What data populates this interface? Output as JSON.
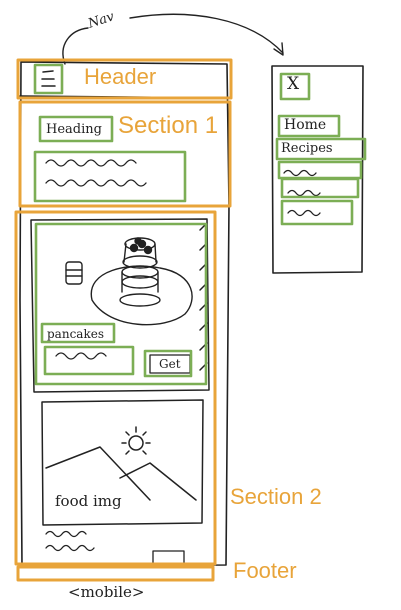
{
  "annotations": {
    "header": "Header",
    "section_1": "Section 1",
    "section_2": "Section 2",
    "footer": "Footer",
    "nav": "Nav",
    "mobile": "<mobile>"
  },
  "sketch": {
    "heading": "Heading",
    "card_title": "pancakes",
    "card_button": "Get",
    "food_img": "food img",
    "hamburger": "☰",
    "close": "X",
    "menu": [
      "Home",
      "Recipes"
    ]
  },
  "colors": {
    "annotation_orange": "#E8A43A",
    "annotation_green": "#7CAE55",
    "ink": "#222222"
  }
}
